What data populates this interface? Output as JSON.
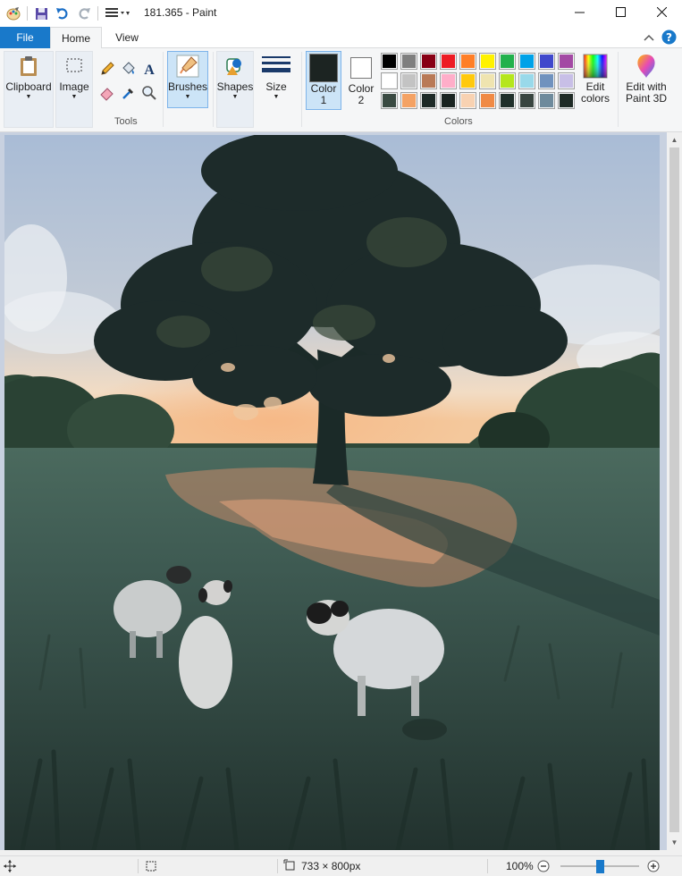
{
  "window": {
    "title": "181.365 - Paint",
    "minimize_icon": "minimize-icon",
    "maximize_icon": "maximize-icon",
    "close_icon": "close-icon"
  },
  "quick_access": [
    "paint-app-icon",
    "save-icon",
    "undo-icon",
    "redo-icon",
    "customize-icon"
  ],
  "tabs": {
    "file": "File",
    "home": "Home",
    "view": "View"
  },
  "ribbon": {
    "clipboard": "Clipboard",
    "image": "Image",
    "tools_group": "Tools",
    "brushes": "Brushes",
    "shapes": "Shapes",
    "size": "Size",
    "color1_line1": "Color",
    "color1_line2": "1",
    "color2_line1": "Color",
    "color2_line2": "2",
    "colors_group": "Colors",
    "edit_colors_line1": "Edit",
    "edit_colors_line2": "colors",
    "paint3d_line1": "Edit with",
    "paint3d_line2": "Paint 3D"
  },
  "colors": {
    "color1": "#1c2422",
    "color2": "#ffffff",
    "palette_row1": [
      "#000000",
      "#7f7f7f",
      "#880015",
      "#ed1c24",
      "#ff7f27",
      "#fff200",
      "#22b14c",
      "#00a2e8",
      "#3f48cc",
      "#a349a4"
    ],
    "palette_row2": [
      "#ffffff",
      "#c3c3c3",
      "#b97a57",
      "#ffaec9",
      "#ffc90e",
      "#efe4b0",
      "#b5e61d",
      "#99d9ea",
      "#7092be",
      "#c8bfe7"
    ],
    "palette_row3": [
      "#3a4a42",
      "#f4a264",
      "#1e2a27",
      "#1a2421",
      "#f8d2b2",
      "#f08a45",
      "#20302b",
      "#394540",
      "#6e8a9c",
      "#1f2b26",
      "#2f3b22"
    ]
  },
  "status": {
    "size_text": "733 × 800px",
    "zoom_text": "100%",
    "zoom_level_percent": 100
  }
}
